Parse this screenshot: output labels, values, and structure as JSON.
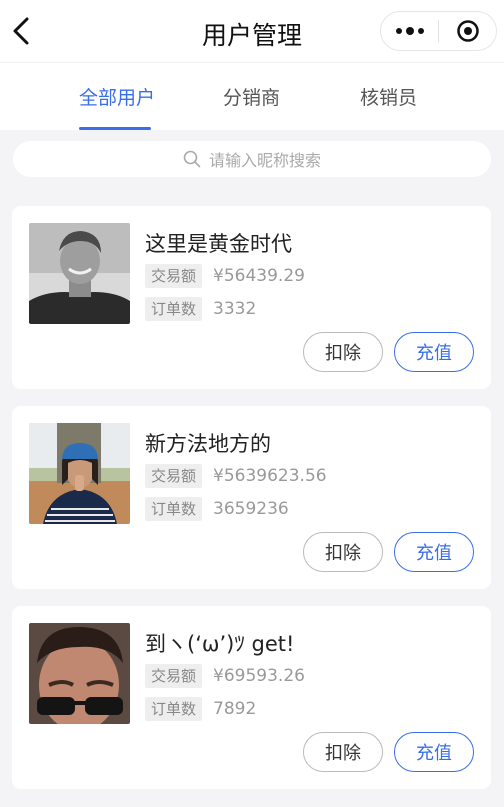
{
  "navbar": {
    "title": "用户管理"
  },
  "tabs": [
    {
      "label": "全部用户",
      "active": true
    },
    {
      "label": "分销商",
      "active": false
    },
    {
      "label": "核销员",
      "active": false
    }
  ],
  "search": {
    "placeholder": "请输入昵称搜索"
  },
  "users": [
    {
      "name": "这里是黄金时代",
      "amount_label": "交易额",
      "amount": "¥56439.29",
      "orders_label": "订单数",
      "orders": "3332",
      "deduct_label": "扣除",
      "recharge_label": "充值"
    },
    {
      "name": "新方法地方的",
      "amount_label": "交易额",
      "amount": "¥5639623.56",
      "orders_label": "订单数",
      "orders": "3659236",
      "deduct_label": "扣除",
      "recharge_label": "充值"
    },
    {
      "name": "到ヽ(‘ω’)ﾂ get!",
      "amount_label": "交易额",
      "amount": "¥69593.26",
      "orders_label": "订单数",
      "orders": "7892",
      "deduct_label": "扣除",
      "recharge_label": "充值"
    }
  ],
  "colors": {
    "accent": "#3a6ee8",
    "page_bg": "#f4f4f6"
  }
}
